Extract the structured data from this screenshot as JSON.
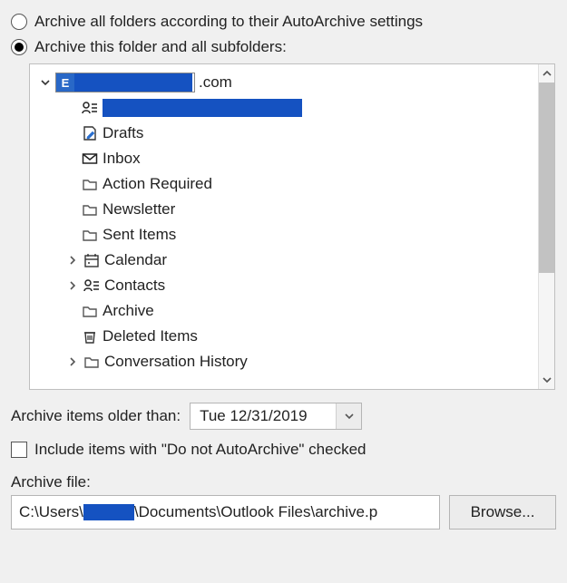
{
  "radio": {
    "opt1": "Archive all folders according to their AutoArchive settings",
    "opt2": "Archive this folder and all subfolders:",
    "selected": 2
  },
  "tree": {
    "account_suffix": ".com",
    "items": [
      {
        "label": "",
        "redacted": true
      },
      {
        "label": "Drafts"
      },
      {
        "label": "Inbox"
      },
      {
        "label": "Action Required"
      },
      {
        "label": "Newsletter"
      },
      {
        "label": "Sent Items"
      },
      {
        "label": "Calendar",
        "expandable": true
      },
      {
        "label": "Contacts",
        "expandable": true
      },
      {
        "label": "Archive"
      },
      {
        "label": "Deleted Items"
      },
      {
        "label": "Conversation History",
        "expandable": true
      }
    ]
  },
  "dateRow": {
    "label": "Archive items older than:",
    "value": "Tue 12/31/2019"
  },
  "includeRow": {
    "label": "Include items with \"Do not AutoArchive\" checked"
  },
  "fileRow": {
    "label": "Archive file:",
    "path_prefix": "C:\\Users\\",
    "path_suffix": "\\Documents\\Outlook Files\\archive.p",
    "browse": "Browse..."
  }
}
